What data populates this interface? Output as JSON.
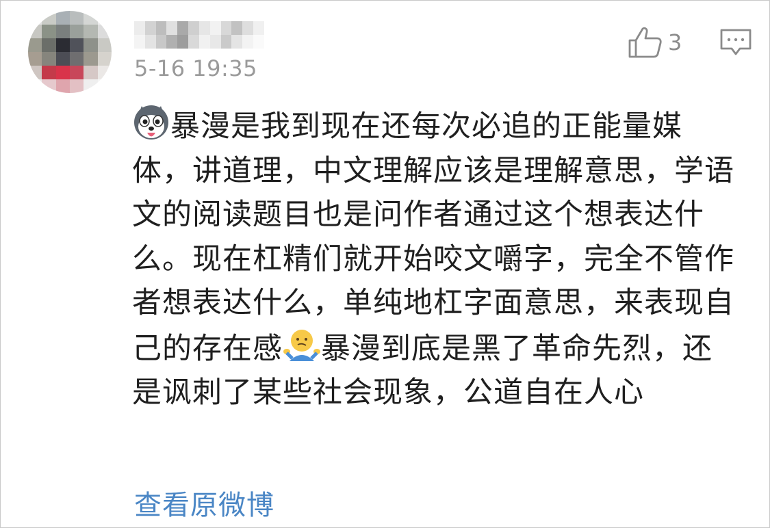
{
  "comment": {
    "timestamp": "5-16 19:35",
    "like_count": "3",
    "body_segments": [
      {
        "type": "emoji",
        "icon": "husky-dog-emoji-icon"
      },
      {
        "type": "text",
        "text": "暴漫是我到现在还每次必追的正能量媒体，讲道理，中文理解应该是理解意思，学语文的阅读题目也是问作者通过这个想表达什么。现在杠精们就开始咬文嚼字，完全不管作者想表达什么，单纯地杠字面意思，来表现自己的存在感"
      },
      {
        "type": "emoji",
        "icon": "shrug-emoji-icon"
      },
      {
        "type": "text",
        "text": "暴漫到底是黑了革命先烈，还是讽刺了某些社会现象，公道自在人心"
      }
    ],
    "view_original_label": "查看原微博"
  },
  "icons": {
    "like": "thumbs-up-icon",
    "reply": "comment-bubble-icon"
  },
  "colors": {
    "timestamp": "#9a9a9a",
    "link": "#4a86c5",
    "icon": "#8a8a8a"
  }
}
